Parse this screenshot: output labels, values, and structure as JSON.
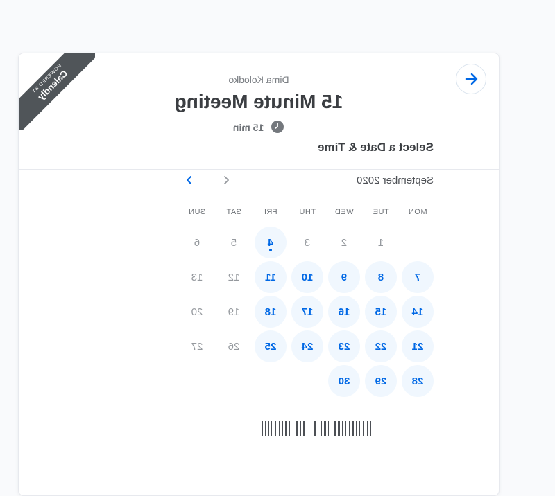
{
  "badge": {
    "powered_label": "POWERED BY",
    "brand": "Calendly"
  },
  "event": {
    "owner": "Dima Kolodko",
    "title": "15 Minute Meeting",
    "duration": "15 min"
  },
  "calendar": {
    "heading": "Select a Date & Time",
    "month": "September 2020",
    "weekdays": [
      "MON",
      "TUE",
      "WED",
      "THU",
      "FRI",
      "SAT",
      "SUN"
    ],
    "weeks": [
      [
        {
          "d": "",
          "s": "none"
        },
        {
          "d": "1",
          "s": "unavail"
        },
        {
          "d": "2",
          "s": "unavail"
        },
        {
          "d": "3",
          "s": "unavail"
        },
        {
          "d": "4",
          "s": "today"
        },
        {
          "d": "5",
          "s": "unavail"
        },
        {
          "d": "6",
          "s": "unavail"
        }
      ],
      [
        {
          "d": "7",
          "s": "avail"
        },
        {
          "d": "8",
          "s": "avail"
        },
        {
          "d": "9",
          "s": "avail"
        },
        {
          "d": "10",
          "s": "avail"
        },
        {
          "d": "11",
          "s": "avail"
        },
        {
          "d": "12",
          "s": "unavail"
        },
        {
          "d": "13",
          "s": "unavail"
        }
      ],
      [
        {
          "d": "14",
          "s": "avail"
        },
        {
          "d": "15",
          "s": "avail"
        },
        {
          "d": "16",
          "s": "avail"
        },
        {
          "d": "17",
          "s": "avail"
        },
        {
          "d": "18",
          "s": "avail"
        },
        {
          "d": "19",
          "s": "unavail"
        },
        {
          "d": "20",
          "s": "unavail"
        }
      ],
      [
        {
          "d": "21",
          "s": "avail"
        },
        {
          "d": "22",
          "s": "avail"
        },
        {
          "d": "23",
          "s": "avail"
        },
        {
          "d": "24",
          "s": "avail"
        },
        {
          "d": "25",
          "s": "avail"
        },
        {
          "d": "26",
          "s": "unavail"
        },
        {
          "d": "27",
          "s": "unavail"
        }
      ],
      [
        {
          "d": "28",
          "s": "avail"
        },
        {
          "d": "29",
          "s": "avail"
        },
        {
          "d": "30",
          "s": "avail"
        },
        {
          "d": "",
          "s": "none"
        },
        {
          "d": "",
          "s": "none"
        },
        {
          "d": "",
          "s": "none"
        },
        {
          "d": "",
          "s": "none"
        }
      ]
    ]
  },
  "colors": {
    "accent": "#0068e5",
    "available_bg": "#f0f7fe",
    "ribbon": "#505559"
  },
  "icons": {
    "back": "arrow-left-icon",
    "clock": "clock-icon",
    "prev": "chevron-left-icon",
    "next": "chevron-right-icon"
  }
}
